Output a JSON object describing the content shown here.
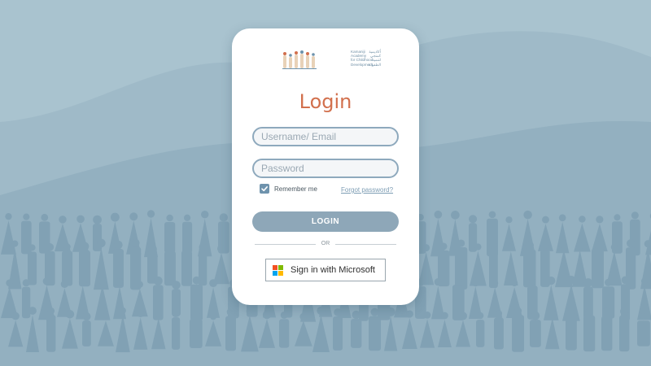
{
  "brand": {
    "name_lines_en": [
      "Kamaniji",
      "Academy",
      "for Childhood",
      "Development"
    ],
    "name_lines_ar": [
      "أكاديمية",
      "كمنجي",
      "لتنمية",
      "الطفولة"
    ]
  },
  "login": {
    "title": "Login",
    "username_placeholder": "Username/ Email",
    "password_placeholder": "Password",
    "remember_label": "Remember me",
    "remember_checked": true,
    "forgot_label": "Forgot password?",
    "login_button": "LOGIN",
    "or_label": "OR",
    "microsoft_button": "Sign in with Microsoft"
  },
  "colors": {
    "background": "#a9c3cf",
    "wave": "#93b0c0",
    "figures": "#7f9fb3",
    "title": "#d2704d",
    "button": "#8ea7b8",
    "field_border": "#8ea9bd"
  },
  "icons": {
    "brand_logo": "family-figures-logo",
    "checkbox": "check-icon",
    "microsoft": "microsoft-logo-icon"
  }
}
